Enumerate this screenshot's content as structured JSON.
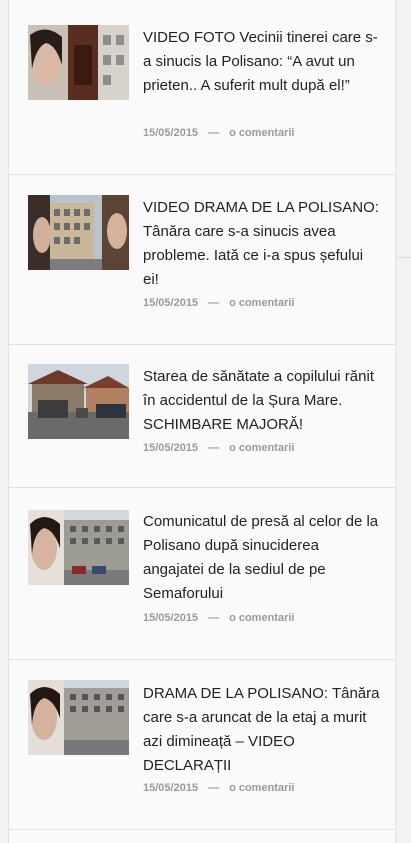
{
  "articles": [
    {
      "title": "VIDEO FOTO Vecinii tinerei care s-a sinucis la Polisano: “A avut un prieten.. A suferit mult după el!”",
      "date": "15/05/2015",
      "comments": "o comentarii"
    },
    {
      "title": "VIDEO DRAMA DE LA POLISANO: Tânăra care s-a sinucis avea probleme. Iată ce i-a spus șefului ei!",
      "date": "15/05/2015",
      "comments": "o comentarii"
    },
    {
      "title": "Starea de sănătate a copilului rănit în accidentul de la Șura Mare. SCHIMBARE MAJORĂ!",
      "date": "15/05/2015",
      "comments": "o comentarii"
    },
    {
      "title": "Comunicatul de presă al celor de la Polisano după sinuciderea angajatei de la sediul de pe Semaforului",
      "date": "15/05/2015",
      "comments": "o comentarii"
    },
    {
      "title": "DRAMA DE LA POLISANO: Tânăra care s-a aruncat de la etaj a murit azi dimineață – VIDEO DECLARAȚII",
      "date": "15/05/2015",
      "comments": "o comentarii"
    }
  ],
  "meta_separator": "—"
}
